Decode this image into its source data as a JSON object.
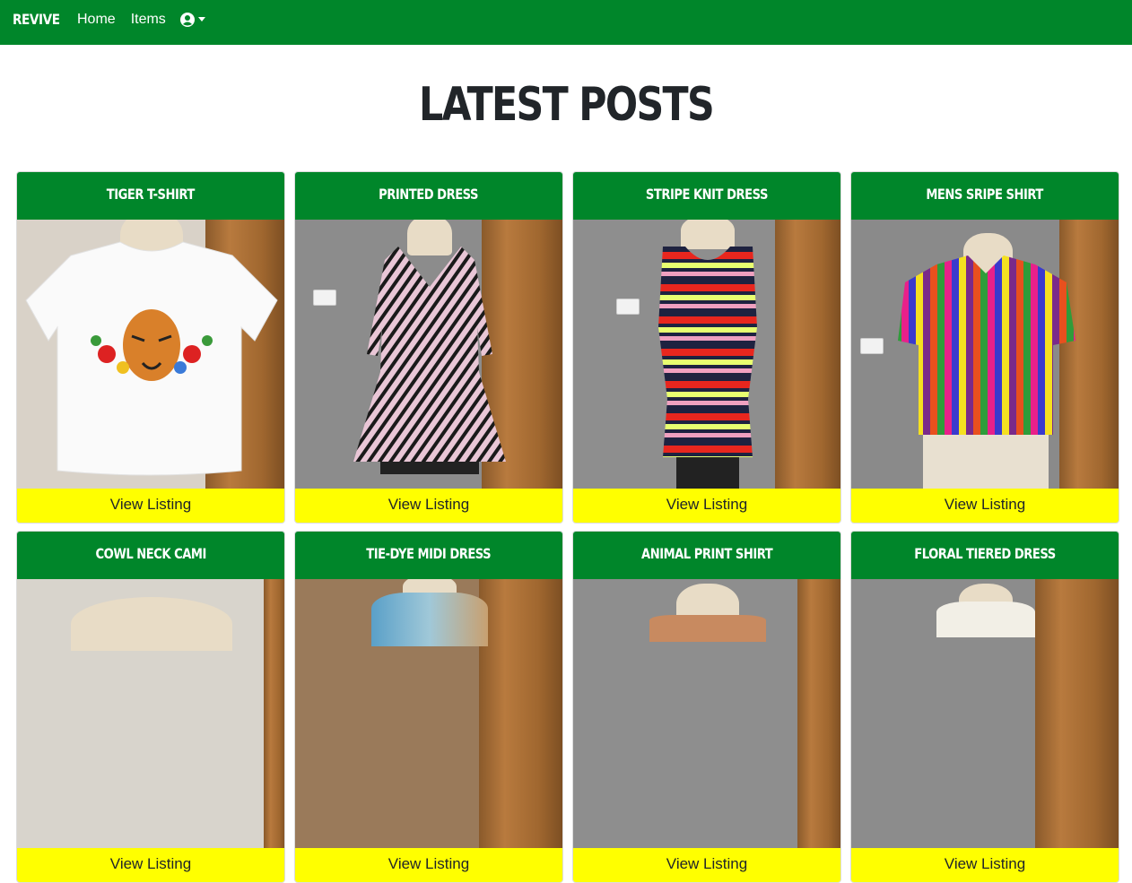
{
  "navbar": {
    "brand": "REVIVE",
    "links": [
      "Home",
      "Items"
    ],
    "user_icon": "user-circle-icon",
    "color": "#00862a"
  },
  "page": {
    "title": "LATEST POSTS"
  },
  "cards": [
    {
      "title": "TIGER T-SHIRT",
      "button": "View Listing"
    },
    {
      "title": "PRINTED DRESS",
      "button": "View Listing"
    },
    {
      "title": "STRIPE KNIT DRESS",
      "button": "View Listing"
    },
    {
      "title": "MENS SRIPE SHIRT",
      "button": "View Listing"
    },
    {
      "title": "COWL NECK CAMI",
      "button": "View Listing"
    },
    {
      "title": "TIE-DYE MIDI DRESS",
      "button": "View Listing"
    },
    {
      "title": "ANIMAL PRINT SHIRT",
      "button": "View Listing"
    },
    {
      "title": "FLORAL TIERED DRESS",
      "button": "View Listing"
    }
  ],
  "colors": {
    "header": "#00862a",
    "button": "#ffff00"
  }
}
